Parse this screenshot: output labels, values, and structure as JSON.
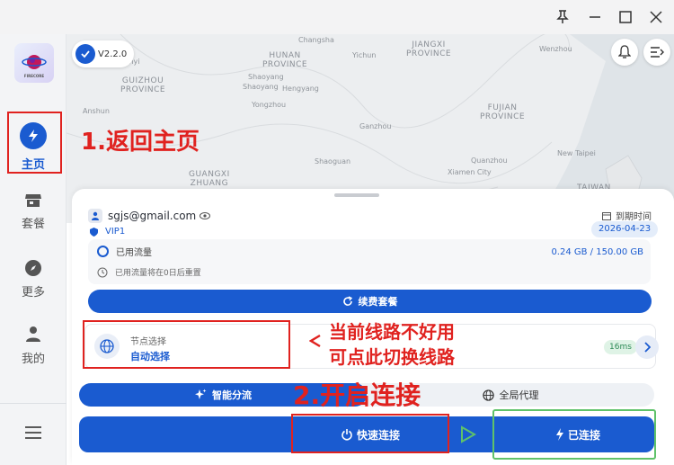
{
  "window": {
    "pin_icon": "pin-icon",
    "minimize_icon": "minimize-icon",
    "maximize_icon": "maximize-icon",
    "close_icon": "close-icon"
  },
  "sidebar": {
    "logo_text": "FIRECORE",
    "items": [
      {
        "label": "主页",
        "icon": "lightning-icon",
        "active": true
      },
      {
        "label": "套餐",
        "icon": "store-icon"
      },
      {
        "label": "更多",
        "icon": "compass-icon"
      },
      {
        "label": "我的",
        "icon": "person-icon"
      }
    ],
    "menu_icon": "hamburger-icon"
  },
  "map": {
    "version": "V2.2.0",
    "regions": [
      "HUNAN\nPROVINCE",
      "JIANGXI\nPROVINCE",
      "GUIZHOU\nPROVINCE",
      "FUJIAN\nPROVINCE",
      "GUANGXI\nZHUANG",
      "TAIWAN"
    ],
    "cities": [
      "Changsha",
      "Yichun",
      "Wenzhou",
      "Lunyi",
      "Shaoyang",
      "Shaoyang",
      "Hengyang",
      "Yongzhou",
      "Anshun",
      "Ganzhou",
      "Quanzhou",
      "New Taipei",
      "Shaoguan",
      "Xiamen City"
    ]
  },
  "account": {
    "email": "sgjs@gmail.com",
    "vip": "VIP1",
    "expire_label": "到期时间",
    "expire_date": "2026-04-23",
    "traffic_label": "已用流量",
    "traffic_value": "0.24 GB / 150.00 GB",
    "reset_text": "已用流量将在0日后重置",
    "traffic_used_fraction": 0.0016
  },
  "renew_label": "续费套餐",
  "node": {
    "title": "节点选择",
    "value": "自动选择",
    "latency": "16ms"
  },
  "modes": {
    "smart": "智能分流",
    "global": "全局代理"
  },
  "connect": {
    "quick": "快速连接",
    "connected": "已连接"
  },
  "annotations": {
    "step1": "1.返回主页",
    "step2": "2.开启连接",
    "tip_line1": "当前线路不好用",
    "tip_line2": "可点此切换线路"
  },
  "colors": {
    "accent": "#1a5bd0",
    "annotation_red": "#e0221f",
    "annotation_green": "#5fc26a"
  }
}
